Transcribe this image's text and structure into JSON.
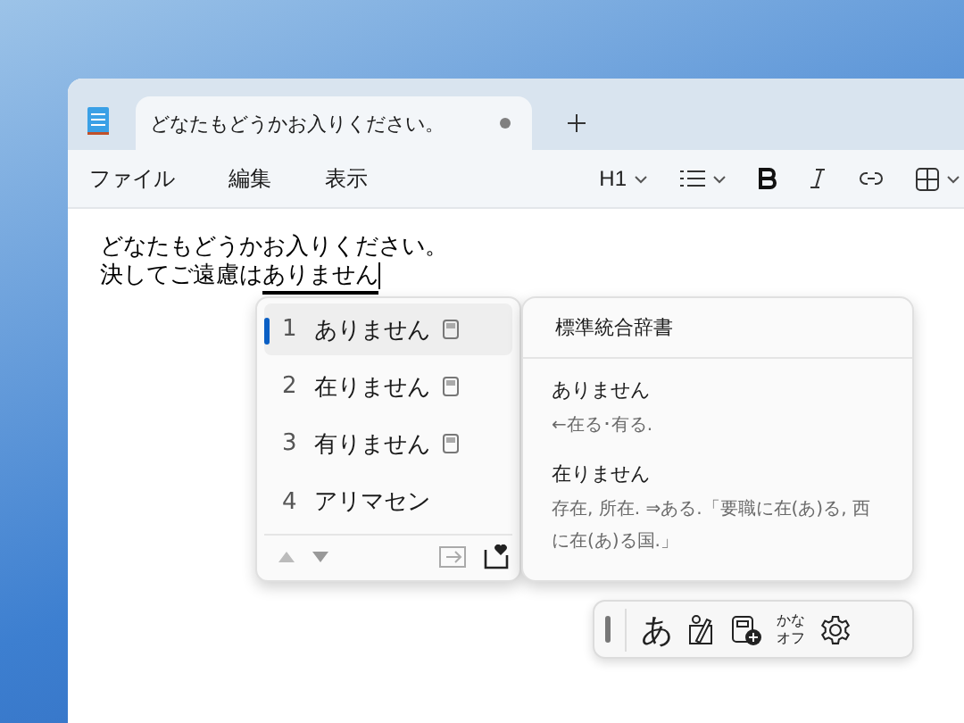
{
  "tabs": [
    {
      "title": "どなたもどうかお入りください。",
      "selected": true,
      "modified": true
    }
  ],
  "menu": [
    "ファイル",
    "編集",
    "表示"
  ],
  "toolbar": {
    "heading": "H1"
  },
  "document": {
    "lines": [
      {
        "text": "どなたもどうかお入りください。"
      },
      {
        "text": "決してご遠慮は",
        "composing": "ありません"
      }
    ]
  },
  "candidates": [
    {
      "number": "1",
      "text": "ありません",
      "selected": true,
      "has_dictionary": true
    },
    {
      "number": "2",
      "text": "在りません",
      "selected": false,
      "has_dictionary": true
    },
    {
      "number": "3",
      "text": "有りません",
      "selected": false,
      "has_dictionary": true
    },
    {
      "number": "4",
      "text": "アリマセン",
      "selected": false,
      "has_dictionary": false
    }
  ],
  "dictionary": {
    "title": "標準統合辞書",
    "entries": [
      {
        "headword": "ありません",
        "definition": "←在る･有る."
      },
      {
        "headword": "在りません",
        "definition": "存在, 所在. ⇒ある.「要職に在(あ)る, 西に在(あ)る国.」"
      }
    ]
  },
  "ime_toolbar": {
    "mode": "あ",
    "kana_top": "かな",
    "kana_bottom": "オフ"
  }
}
